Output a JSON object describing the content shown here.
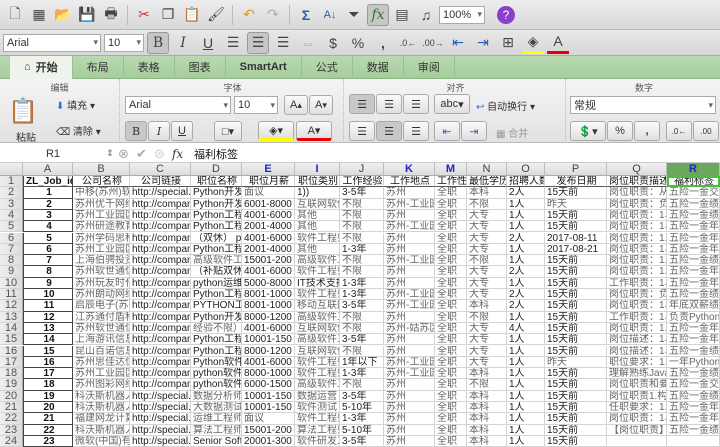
{
  "toolbar": {
    "zoom": "100%",
    "icons": [
      "new-icon",
      "gallery-icon",
      "open-icon",
      "save-icon",
      "print-icon",
      "cut-icon",
      "copy-icon",
      "paste-icon",
      "format-painter-icon",
      "undo-icon",
      "redo-icon",
      "autosum-icon",
      "sort-icon",
      "filter-icon",
      "formula-builder-icon",
      "show-icon",
      "media-icon",
      "help-icon"
    ]
  },
  "format_bar": {
    "font": "Arial",
    "size": "10",
    "bold": "B",
    "italic": "I",
    "underline": "U",
    "percent": "%",
    "comma": ","
  },
  "tabs": [
    {
      "label": "开始"
    },
    {
      "label": "布局"
    },
    {
      "label": "表格"
    },
    {
      "label": "图表"
    },
    {
      "label": "SmartArt"
    },
    {
      "label": "公式"
    },
    {
      "label": "数据"
    },
    {
      "label": "审阅"
    }
  ],
  "ribbon": {
    "edit": {
      "title": "编辑",
      "paste": "粘贴",
      "fill": "填充",
      "clear": "清除"
    },
    "font": {
      "title": "字体",
      "font": "Arial",
      "size": "10",
      "bold": "B",
      "italic": "I",
      "underline": "U"
    },
    "align": {
      "title": "对齐",
      "abc": "abc",
      "wrap": "自动换行",
      "merge": "合并"
    },
    "number": {
      "title": "数字",
      "format": "常规",
      "percent": "%"
    }
  },
  "formula_bar": {
    "cell_ref": "R1",
    "fx": "fx",
    "content": "福利标签"
  },
  "columns": [
    "A",
    "B",
    "C",
    "D",
    "E",
    "I",
    "J",
    "K",
    "M",
    "N",
    "O",
    "P",
    "Q",
    "R"
  ],
  "rows": [
    [
      "ZL_Job_id",
      "公司名称",
      "公司链接",
      "职位名称",
      "职位月薪",
      "职位类别",
      "工作经验",
      "工作地点",
      "工作性质",
      "最低学历",
      "招聘人数",
      "发布日期",
      "岗位职责描述",
      "福利标签"
    ],
    [
      "1",
      "中移(苏州)软",
      "http://special.z",
      "Python开发",
      "面议",
      "1))",
      "3-5年",
      "苏州",
      "全职",
      "本科",
      "2人",
      "15天前",
      "岗位职责：从",
      "五险一金交通"
    ],
    [
      "2",
      "苏州优千网络",
      "http://compan",
      "Python开发",
      "6001-8000",
      "互联网软件",
      "不限",
      "苏州-工业园",
      "全职",
      "不限",
      "1人",
      "昨天",
      "岗位职责：负",
      "五险一金绩效"
    ],
    [
      "3",
      "苏州工业园区",
      "http://compan",
      "Python工程",
      "4001-6000",
      "其他",
      "不限",
      "苏州",
      "全职",
      "大专",
      "1人",
      "15天前",
      "岗位职责：1、",
      "五险一金绩效"
    ],
    [
      "4",
      "苏州研途教育",
      "http://compan",
      "Python工程",
      "2001-4000",
      "其他",
      "不限",
      "苏州-工业园",
      "全职",
      "大专",
      "1人",
      "15天前",
      "岗位职责：1、",
      "五险一金年底"
    ],
    [
      "5",
      "苏州学码思科",
      "http://compan",
      "（双休） py",
      "4001-6000",
      "软件工程师",
      "不限",
      "苏州",
      "全职",
      "大专",
      "2人",
      "2017-08-11",
      "岗位职责：1.1",
      "五险一金年底"
    ],
    [
      "6",
      "苏州工业园区",
      "http://compan",
      "Python工程",
      "2001-4000",
      "其他",
      "1-3年",
      "苏州",
      "全职",
      "大专",
      "1人",
      "2017-08-21",
      "岗位职责：1、",
      "五险一金年底"
    ],
    [
      "7",
      "上海伯骋投资",
      "http://compan",
      "高级软件工",
      "15001-200",
      "高级软件工",
      "不限",
      "苏州-工业园",
      "全职",
      "不限",
      "1人",
      "15天前",
      "岗位职责：1.8",
      "五险一金绩效"
    ],
    [
      "8",
      "苏州软世通信",
      "http://compan",
      "（补贴双休",
      "4001-6000",
      "软件工程师",
      "不限",
      "苏州",
      "全职",
      "大专",
      "2人",
      "15天前",
      "岗位职责：1.1",
      "五险一金年底"
    ],
    [
      "9",
      "苏州玩友时代",
      "http://compan",
      "python运维",
      "5000-8000",
      "IT技术支持",
      "1-3年",
      "苏州",
      "全职",
      "大专",
      "1人",
      "15天前",
      "工作职责：1、",
      "五险一金年底"
    ],
    [
      "10",
      "苏州朗动网络",
      "http://compan",
      "Python工程",
      "8001-1000",
      "软件工程师",
      "1-3年",
      "苏州-工业园",
      "全职",
      "大专",
      "2人",
      "15天前",
      "岗位职责：负",
      "五险一金绩效"
    ],
    [
      "11",
      "启辰电子(苏州",
      "http://compan",
      "PYTHON工",
      "8001-1000",
      "移动互联网",
      "3-5年",
      "苏州-工业园",
      "全职",
      "本科",
      "2人",
      "15天前",
      "岗位职责：1、",
      "年底双薪绩效"
    ],
    [
      "12",
      "江苏通付盾科",
      "http://compan",
      "Python开发",
      "8000-1200",
      "高级软件工",
      "不限",
      "苏州",
      "全职",
      "不限",
      "1人",
      "15天前",
      "工作职责：1、",
      "负责Python"
    ],
    [
      "13",
      "苏州软世通信",
      "http://compan",
      "经验不限）",
      "4001-6000",
      "互联网软件",
      "不限",
      "苏州-姑苏区",
      "全职",
      "大专",
      "4人",
      "15天前",
      "岗位职责：1.",
      "五险一金年底"
    ],
    [
      "14",
      "上海游讯信息",
      "http://compan",
      "Python工程",
      "10001-150",
      "高级软件工",
      "3-5年",
      "苏州",
      "全职",
      "大专",
      "1人",
      "15天前",
      "岗位描述：1、",
      "五险一金年底"
    ],
    [
      "15",
      "昆山百诺信息",
      "http://compan",
      "Python工程",
      "8000-1200",
      "互联网软件",
      "不限",
      "苏州",
      "全职",
      "大专",
      "1人",
      "15天前",
      "岗位描述：1、",
      "五险一金绩效"
    ],
    [
      "16",
      "苏州思佳达信",
      "http://compan",
      "Python软件",
      "4001-6000",
      "软件工程师",
      "1年以下",
      "苏州-工业园",
      "全职",
      "大专",
      "1人",
      "昨天",
      "职位要求：1.",
      "一年Python开"
    ],
    [
      "17",
      "苏州工业园区",
      "http://compan",
      "python软件",
      "8000-1000",
      "软件工程师",
      "1-3年",
      "苏州-工业园",
      "全职",
      "本科",
      "1人",
      "15天前",
      "理解熟练Java",
      "五险一金绩效"
    ],
    [
      "18",
      "苏州图彩网络",
      "http://compan",
      "python软件",
      "6000-1500",
      "高级软件工",
      "不限",
      "苏州",
      "全职",
      "不限",
      "1人",
      "15天前",
      "岗位职责和要",
      "五险一金交通"
    ],
    [
      "19",
      "科沃斯机器人",
      "http://special.z",
      "数据分析师",
      "10001-150",
      "数据运营",
      "3-5年",
      "苏州",
      "全职",
      "本科",
      "1人",
      "15天前",
      "岗位职责1.构",
      "五险一金绩效"
    ],
    [
      "20",
      "科沃斯机器人",
      "http://special.z",
      "大数据测试",
      "10001-150",
      "软件测试",
      "5-10年",
      "苏州",
      "全职",
      "本科",
      "1人",
      "15天前",
      "任职要求：1.",
      "五险一金年底"
    ],
    [
      "21",
      "福建网龙计算",
      "http://special.z",
      "运维工程师",
      "面议",
      "软件工程师",
      "1-3年",
      "苏州",
      "全职",
      "本科",
      "1人",
      "15天前",
      "岗位职责：1、",
      "五险一金年底"
    ],
    [
      "22",
      "科沃斯机器人",
      "http://special.z",
      "算法工程师",
      "15001-200",
      "算法工程师",
      "5-10年",
      "苏州",
      "全职",
      "本科",
      "1人",
      "15天前",
      "【岗位职责】",
      "五险一金绩效"
    ],
    [
      "23",
      "微软(中国)有",
      "http://special.z",
      "Senior Soft",
      "20001-300",
      "软件研发工",
      "3-5年",
      "苏州",
      "全职",
      "本科",
      "1人",
      "15天前",
      "",
      ""
    ]
  ]
}
